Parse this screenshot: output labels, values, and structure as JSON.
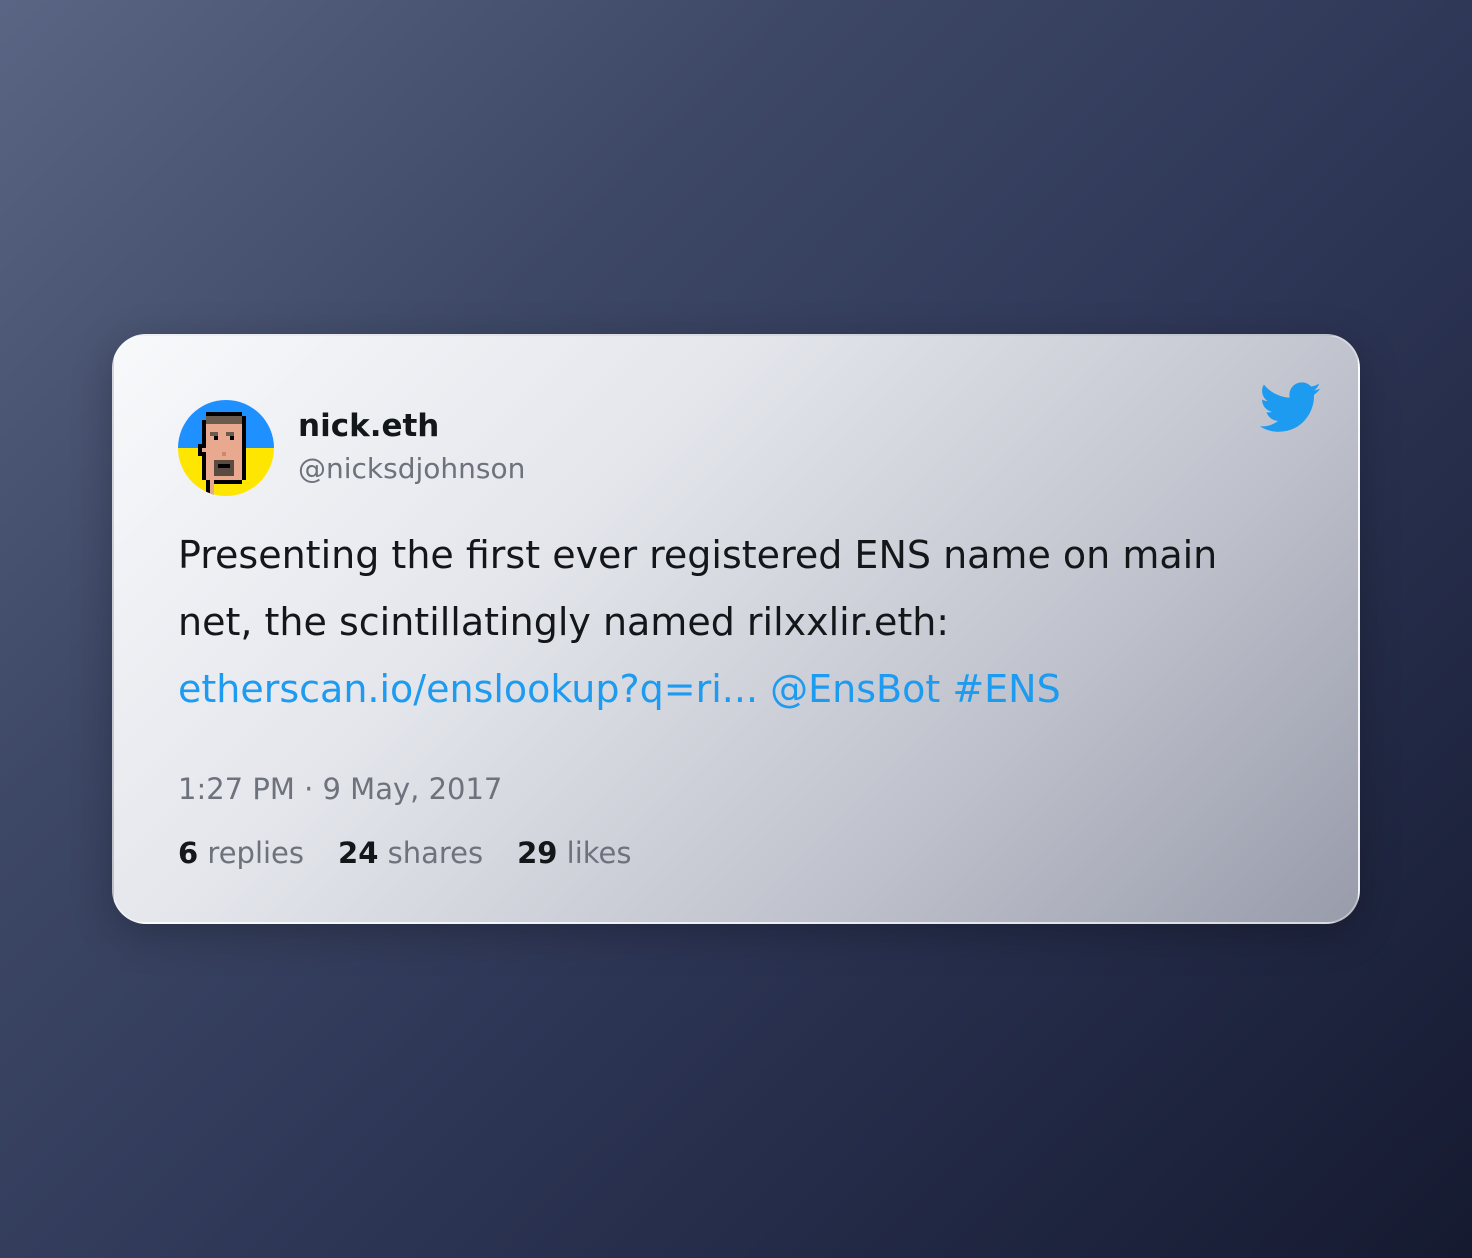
{
  "author": {
    "name": "nick.eth",
    "handle": "@nicksdjohnson"
  },
  "tweet": {
    "line1": "Presenting the first ever registered ENS name on main",
    "line2": "net, the scintillatingly named rilxxlir.eth:",
    "link": "etherscan.io/enslookup?q=ri...",
    "mention": "@EnsBot",
    "hashtag": "#ENS"
  },
  "timestamp": "1:27 PM · 9 May, 2017",
  "stats": {
    "replies": {
      "count": "6",
      "label": "replies"
    },
    "shares": {
      "count": "24",
      "label": "shares"
    },
    "likes": {
      "count": "29",
      "label": "likes"
    }
  },
  "colors": {
    "link": "#1d9bf0",
    "text": "#14171a",
    "muted": "#6d727c",
    "avatar_top": "#1e90ff",
    "avatar_bottom": "#ffe600"
  },
  "icons": {
    "brand": "twitter-bird-icon"
  }
}
